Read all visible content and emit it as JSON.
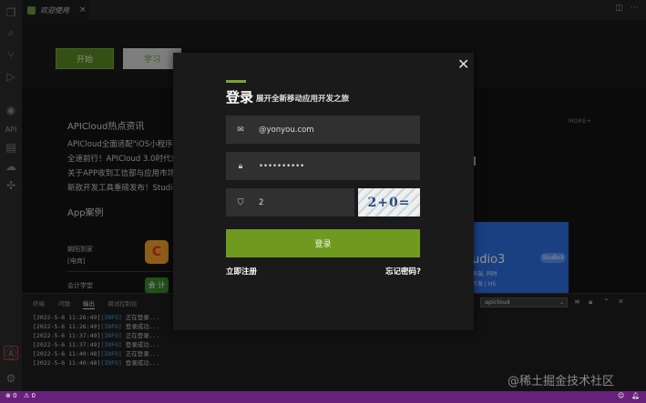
{
  "tab": {
    "label": "欢迎使用",
    "close": "×"
  },
  "activity": {
    "api_label": "API"
  },
  "welcome": {
    "start_label": "开始",
    "learn_label": "学习",
    "news_title": "APICloud热点资讯",
    "news": [
      "APICloud全面适配\"iOS小程序",
      "全速前行！APICloud 3.0时代来",
      "关于APP收到工信部与应用市场",
      "新款开发工具重磅发布！Studio"
    ],
    "more_label": "MORE+",
    "cases_title": "App案例",
    "cases": [
      {
        "line1": "朝阳到家",
        "line2": "[电商]",
        "logo": "C"
      },
      {
        "line1": "会计学堂",
        "line2": "",
        "logo": "会 计"
      }
    ],
    "studio": {
      "title": "udio3",
      "badge": "Studio3",
      "line1": "多端, 同时",
      "line2": "开发 | H5"
    }
  },
  "dialog": {
    "title": "登录",
    "subtitle": "展开全新移动应用开发之旅",
    "email_value": "@yonyou.com",
    "password_value": "••••••••••",
    "captcha_value": "2",
    "captcha_image_text": "2+0=",
    "login_label": "登录",
    "register_label": "立即注册",
    "forgot_label": "忘记密码?",
    "close": "✕"
  },
  "panel": {
    "tabs": [
      "终端",
      "问题",
      "输出",
      "调试控制台"
    ],
    "active_tab": "输出",
    "channel": "apicloud",
    "logs": [
      {
        "time": "[2022-5-6 11:26:49]",
        "level": "[INFO]",
        "msg": " 正在登录..."
      },
      {
        "time": "[2022-5-6 11:26:49]",
        "level": "[INFO]",
        "msg": " 登录成功..."
      },
      {
        "time": "[2022-5-6 11:37:49]",
        "level": "[INFO]",
        "msg": " 正在登录..."
      },
      {
        "time": "[2022-5-6 11:37:49]",
        "level": "[INFO]",
        "msg": " 登录成功..."
      },
      {
        "time": "[2022-5-6 11:40:48]",
        "level": "[INFO]",
        "msg": " 正在登录..."
      },
      {
        "time": "[2022-5-6 11:40:48]",
        "level": "[INFO]",
        "msg": " 登录成功..."
      }
    ]
  },
  "status": {
    "errors": "⊗ 0",
    "warnings": "⚠ 0"
  },
  "watermark": "@稀土掘金技术社区",
  "colors": {
    "accent": "#6f9a1f",
    "status_bar": "#68217a",
    "info": "#4aa3d8"
  }
}
